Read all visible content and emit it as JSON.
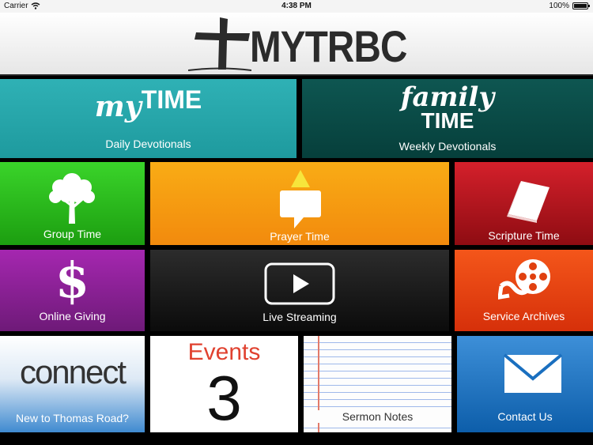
{
  "status_bar": {
    "carrier": "Carrier",
    "time": "4:38 PM",
    "battery": "100%",
    "battery_level": 1.0
  },
  "header": {
    "logo_text": "MYTRBC"
  },
  "tiles": {
    "mytime": {
      "title_my": "my",
      "title_time": "TIME",
      "label": "Daily Devotionals",
      "color": "#2fb1b5"
    },
    "family": {
      "title_family": "family",
      "title_time": "TIME",
      "label": "Weekly Devotionals",
      "color": "#0e5651"
    },
    "group": {
      "label": "Group Time",
      "color": "#3ad42a"
    },
    "prayer": {
      "label": "Prayer Time",
      "color": "#f9ac15"
    },
    "scripture": {
      "label": "Scripture Time",
      "color": "#d4202b"
    },
    "giving": {
      "label": "Online Giving",
      "symbol": "$",
      "color": "#a527b0"
    },
    "live": {
      "label": "Live Streaming",
      "color": "#1b1b1b"
    },
    "archives": {
      "label": "Service Archives",
      "color": "#f4561a"
    },
    "connect": {
      "logo": "connect",
      "label": "New to Thomas Road?",
      "color": "#3f8ad0"
    },
    "events": {
      "title": "Events",
      "count": "3",
      "accent": "#e0412f"
    },
    "notes": {
      "label": "Sermon Notes"
    },
    "contact": {
      "label": "Contact Us",
      "color": "#0d5eaa"
    }
  },
  "icons": {
    "wifi": "wifi-icon",
    "cross": "cross-icon",
    "tree": "tree-icon",
    "speech": "speech-bubble-icon",
    "bible": "bible-icon",
    "dollar": "dollar-icon",
    "play": "play-icon",
    "film": "film-reel-icon",
    "envelope": "envelope-icon"
  }
}
